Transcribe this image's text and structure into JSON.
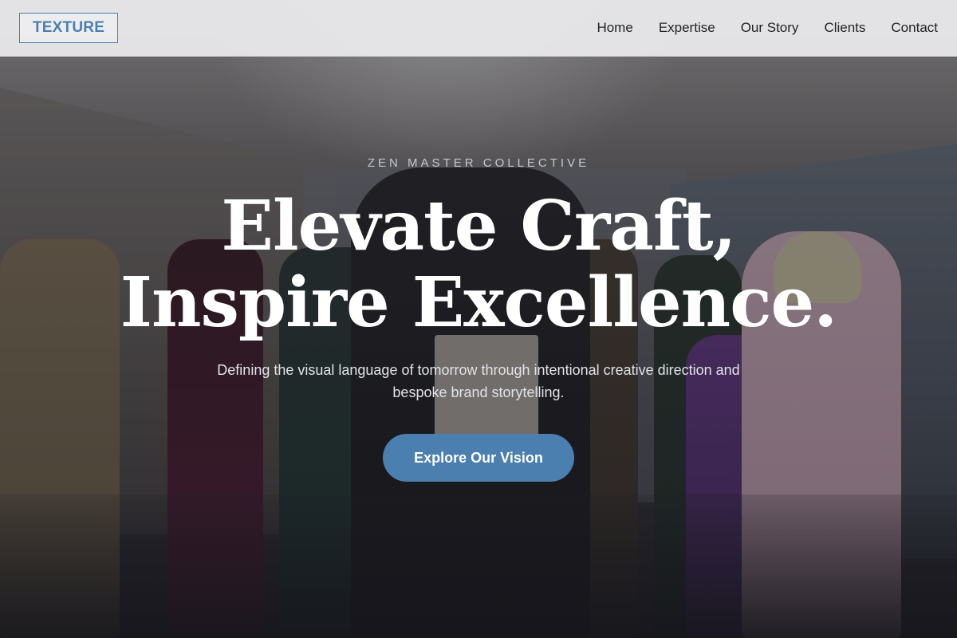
{
  "brand": {
    "logo_text": "TEXTURE",
    "accent_color": "#4a7fb0"
  },
  "nav": {
    "items": [
      {
        "label": "Home"
      },
      {
        "label": "Expertise"
      },
      {
        "label": "Our Story"
      },
      {
        "label": "Clients"
      },
      {
        "label": "Contact"
      }
    ]
  },
  "hero": {
    "eyebrow": "ZEN MASTER COLLECTIVE",
    "headline_line1": "Elevate Craft,",
    "headline_line2": "Inspire Excellence.",
    "subtext": "Defining the visual language of tomorrow through intentional creative direction and bespoke brand storytelling.",
    "cta_label": "Explore Our Vision",
    "background_icon": "fashion-show-photo"
  }
}
